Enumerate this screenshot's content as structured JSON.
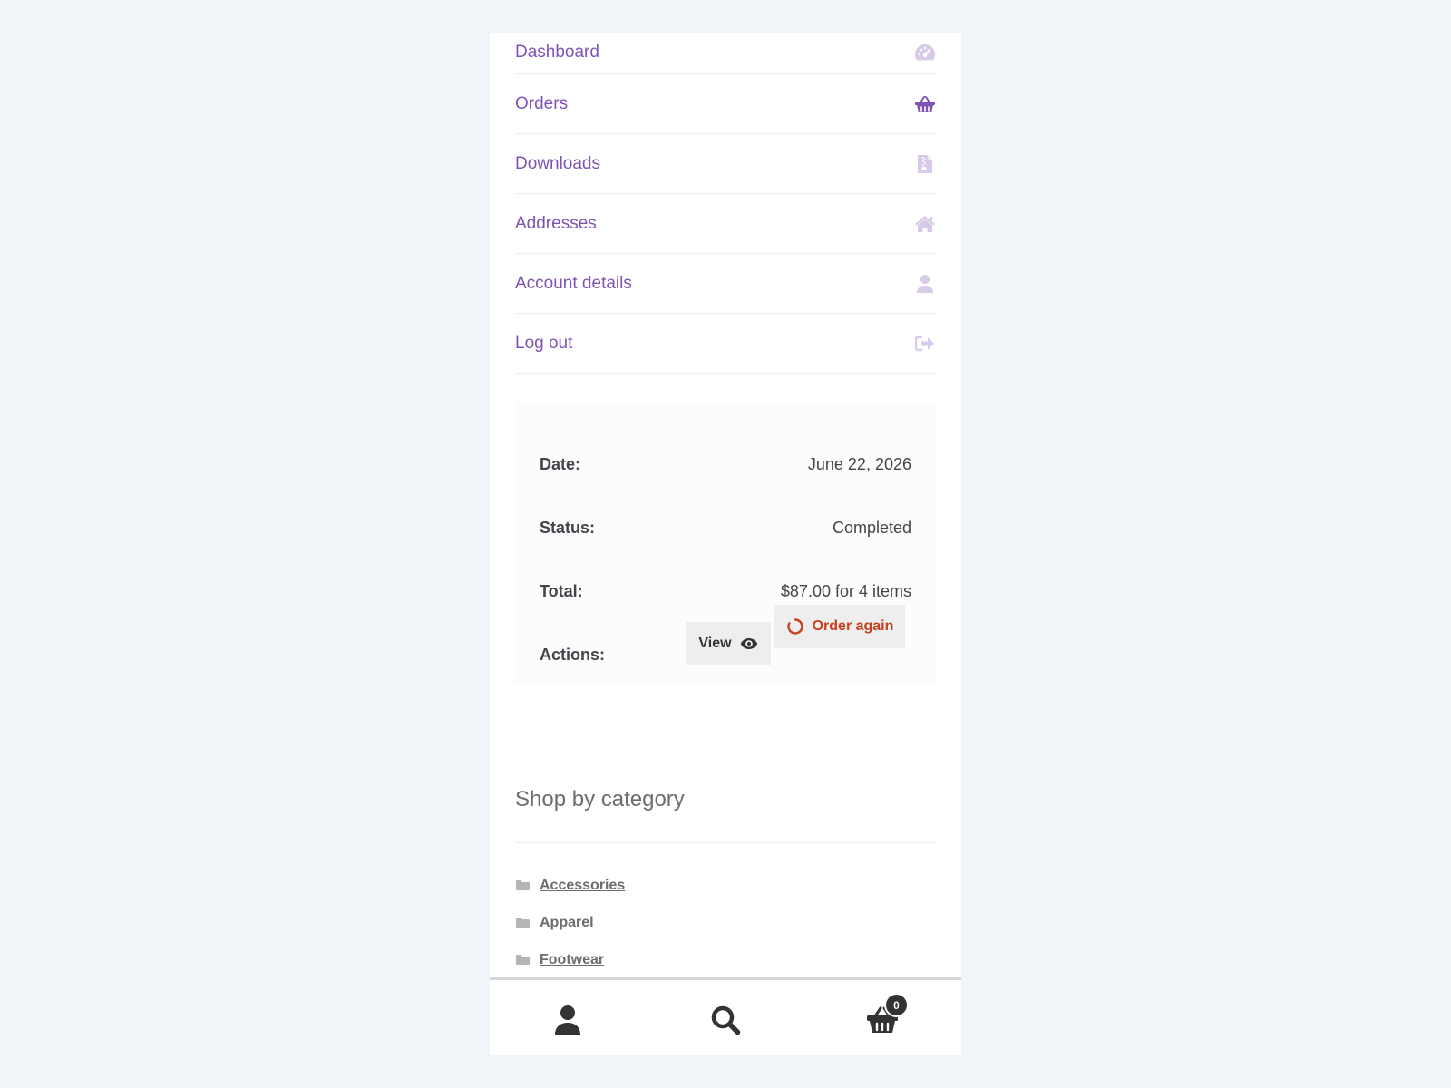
{
  "account_nav": {
    "items": [
      {
        "label": "Dashboard",
        "icon": "dashboard-icon"
      },
      {
        "label": "Orders",
        "icon": "basket-icon"
      },
      {
        "label": "Downloads",
        "icon": "file-icon"
      },
      {
        "label": "Addresses",
        "icon": "home-icon"
      },
      {
        "label": "Account details",
        "icon": "user-icon"
      },
      {
        "label": "Log out",
        "icon": "logout-icon"
      }
    ],
    "active_item": "Orders",
    "accent_color": "#7f54b3",
    "inactive_icon_color": "#d8cbe8"
  },
  "order": {
    "date_label": "Date:",
    "date_value": "June 22, 2026",
    "status_label": "Status:",
    "status_value": "Completed",
    "total_label": "Total:",
    "total_value": "$87.00 for 4 items",
    "actions_label": "Actions:",
    "view_label": "View",
    "order_again_label": "Order again",
    "order_again_color": "#c6401f"
  },
  "shop_by_category": {
    "title": "Shop by category",
    "categories": [
      "Accessories",
      "Apparel",
      "Footwear"
    ]
  },
  "footer": {
    "cart_count": "0",
    "icons": [
      "user-icon",
      "search-icon",
      "cart-icon"
    ]
  }
}
